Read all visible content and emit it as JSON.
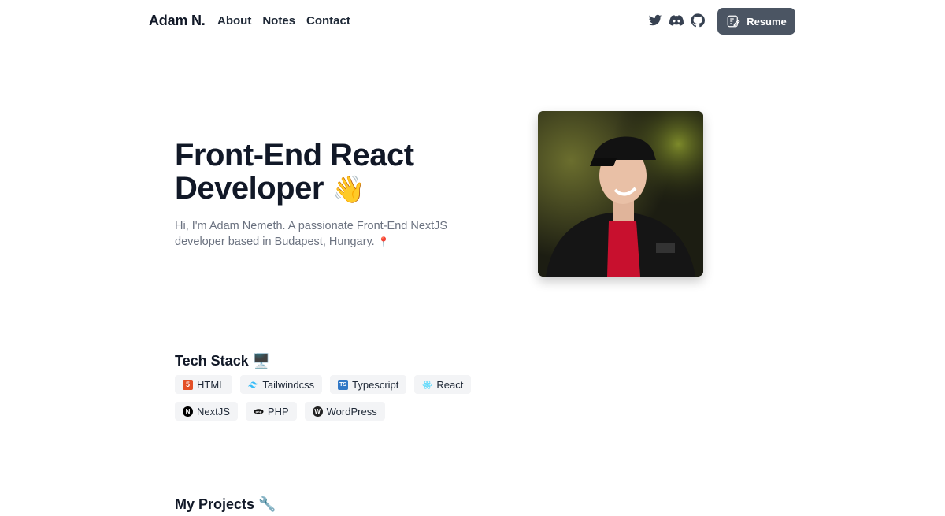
{
  "nav": {
    "brand": "Adam N.",
    "links": [
      "About",
      "Notes",
      "Contact"
    ],
    "social": [
      "twitter-icon",
      "discord-icon",
      "github-icon"
    ],
    "resume_label": "Resume"
  },
  "hero": {
    "title_line1": "Front-End React",
    "title_line2": "Developer",
    "wave_emoji": "👋",
    "subtitle": "Hi, I'm Adam Nemeth. A passionate Front-End NextJS developer based in Budapest, Hungary.",
    "pin_emoji": "📍"
  },
  "tech_stack": {
    "title": "Tech Stack",
    "title_emoji": "🖥️",
    "items": [
      {
        "label": "HTML",
        "icon": "html5-icon",
        "color": "#e34f26"
      },
      {
        "label": "Tailwindcss",
        "icon": "tailwind-icon",
        "color": "#38bdf8"
      },
      {
        "label": "Typescript",
        "icon": "typescript-icon",
        "color": "#3178c6"
      },
      {
        "label": "React",
        "icon": "react-icon",
        "color": "#61dafb"
      },
      {
        "label": "NextJS",
        "icon": "nextjs-icon",
        "color": "#000000"
      },
      {
        "label": "PHP",
        "icon": "php-icon",
        "color": "#777bb4"
      },
      {
        "label": "WordPress",
        "icon": "wordpress-icon",
        "color": "#21759b"
      }
    ]
  },
  "projects": {
    "title": "My Projects",
    "title_emoji": "🔧"
  },
  "colors": {
    "resume_bg": "#4b5563",
    "text_primary": "#111827",
    "text_muted": "#6b7280",
    "chip_bg": "#f3f4f6"
  }
}
